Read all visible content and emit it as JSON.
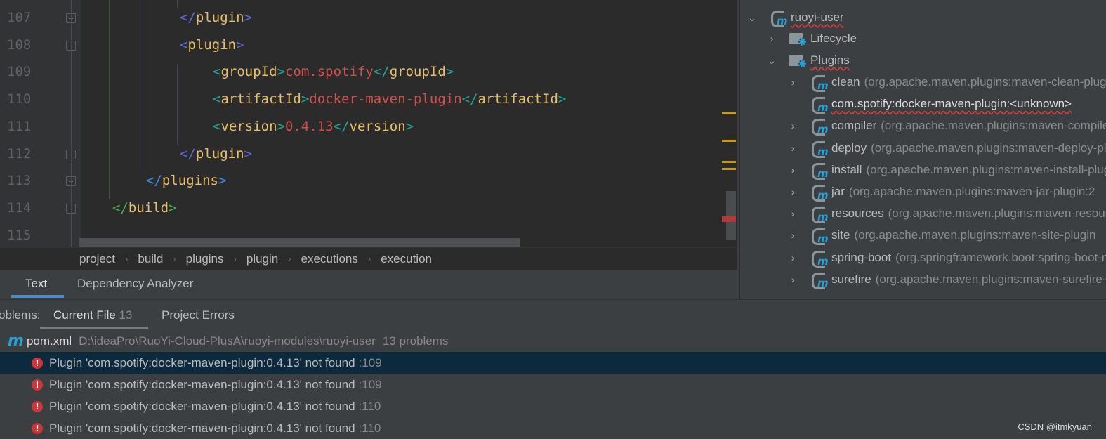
{
  "editor": {
    "lines": [
      {
        "num": "107",
        "segments": [
          [
            "bp",
            "</"
          ],
          [
            "tn",
            "plugin"
          ],
          [
            "bp",
            ">"
          ]
        ],
        "indent": 256
      },
      {
        "num": "108",
        "segments": [
          [
            "bp",
            "<"
          ],
          [
            "tn",
            "plugin"
          ],
          [
            "bp",
            ">"
          ]
        ],
        "indent": 256
      },
      {
        "num": "109",
        "segments": [
          [
            "bt",
            "<"
          ],
          [
            "tn",
            "groupId"
          ],
          [
            "bt",
            ">"
          ],
          [
            "val",
            "com.spotify"
          ],
          [
            "bt",
            "</"
          ],
          [
            "tn",
            "groupId"
          ],
          [
            "bt",
            ">"
          ]
        ],
        "indent": 303
      },
      {
        "num": "110",
        "segments": [
          [
            "bt",
            "<"
          ],
          [
            "tn",
            "artifactId"
          ],
          [
            "bt",
            ">"
          ],
          [
            "val",
            "docker-maven-plugin"
          ],
          [
            "bt",
            "</"
          ],
          [
            "tn",
            "artifactId"
          ],
          [
            "bt",
            ">"
          ]
        ],
        "indent": 303
      },
      {
        "num": "111",
        "segments": [
          [
            "bt",
            "<"
          ],
          [
            "tn",
            "version"
          ],
          [
            "bt",
            ">"
          ],
          [
            "val",
            "0.4.13"
          ],
          [
            "bt",
            "</"
          ],
          [
            "tn",
            "version"
          ],
          [
            "bt",
            ">"
          ]
        ],
        "indent": 303
      },
      {
        "num": "112",
        "segments": [
          [
            "bp",
            "</"
          ],
          [
            "tn",
            "plugin"
          ],
          [
            "bp",
            ">"
          ]
        ],
        "indent": 256
      },
      {
        "num": "113",
        "segments": [
          [
            "bb",
            "</"
          ],
          [
            "tn",
            "plugins"
          ],
          [
            "bb",
            ">"
          ]
        ],
        "indent": 208
      },
      {
        "num": "114",
        "segments": [
          [
            "bg",
            "</"
          ],
          [
            "tn",
            "build"
          ],
          [
            "bg",
            ">"
          ]
        ],
        "indent": 160
      },
      {
        "num": "115",
        "segments": [],
        "indent": 160
      }
    ]
  },
  "breadcrumb": [
    "project",
    "build",
    "plugins",
    "plugin",
    "executions",
    "execution"
  ],
  "editor_tabs": {
    "text": "Text",
    "dependency": "Dependency Analyzer"
  },
  "maven_tree": {
    "module": "ruoyi-user",
    "lifecycle": "Lifecycle",
    "plugins_label": "Plugins",
    "plugins": [
      {
        "name": "clean",
        "detail": "(org.apache.maven.plugins:maven-clean-plugin",
        "expandable": true
      },
      {
        "name": "com.spotify:docker-maven-plugin:<unknown>",
        "detail": "",
        "expandable": false
      },
      {
        "name": "compiler",
        "detail": "(org.apache.maven.plugins:maven-compiler-plugin",
        "expandable": true
      },
      {
        "name": "deploy",
        "detail": "(org.apache.maven.plugins:maven-deploy-plugin",
        "expandable": true
      },
      {
        "name": "install",
        "detail": "(org.apache.maven.plugins:maven-install-plugin",
        "expandable": true
      },
      {
        "name": "jar",
        "detail": "(org.apache.maven.plugins:maven-jar-plugin:2",
        "expandable": true
      },
      {
        "name": "resources",
        "detail": "(org.apache.maven.plugins:maven-resources-plugin",
        "expandable": true
      },
      {
        "name": "site",
        "detail": "(org.apache.maven.plugins:maven-site-plugin",
        "expandable": true
      },
      {
        "name": "spring-boot",
        "detail": "(org.springframework.boot:spring-boot-maven-plugin",
        "expandable": true
      },
      {
        "name": "surefire",
        "detail": "(org.apache.maven.plugins:maven-surefire-plugin",
        "expandable": true
      }
    ]
  },
  "problems": {
    "label": "oblems:",
    "tab_current": "Current File",
    "tab_current_count": "13",
    "tab_project": "Project Errors",
    "file": "pom.xml",
    "path": "D:\\ideaPro\\RuoYi-Cloud-PlusA\\ruoyi-modules\\ruoyi-user",
    "count_text": "13 problems",
    "items": [
      {
        "msg": "Plugin 'com.spotify:docker-maven-plugin:0.4.13' not found",
        "line": ":109"
      },
      {
        "msg": "Plugin 'com.spotify:docker-maven-plugin:0.4.13' not found",
        "line": ":109"
      },
      {
        "msg": "Plugin 'com.spotify:docker-maven-plugin:0.4.13' not found",
        "line": ":110"
      },
      {
        "msg": "Plugin 'com.spotify:docker-maven-plugin:0.4.13' not found",
        "line": ":110"
      }
    ]
  },
  "watermark": "CSDN @itmkyuan"
}
